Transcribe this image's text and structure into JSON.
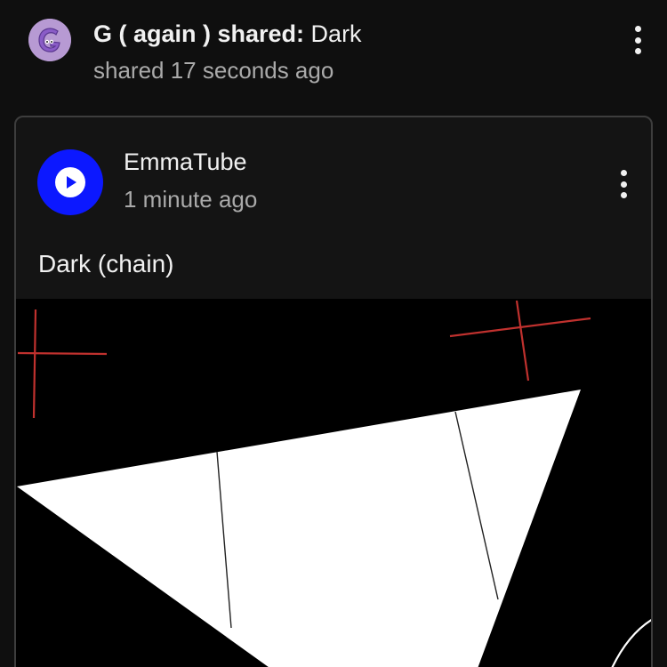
{
  "share": {
    "sharer_name": "G ( again ) shared:",
    "shared_title": " Dark",
    "time": "shared 17 seconds ago",
    "avatar_icon": "letter-g-avatar-icon",
    "avatar_color": "#b79ad3"
  },
  "post": {
    "channel_name": "EmmaTube",
    "time": "1 minute ago",
    "text": "Dark (chain)",
    "avatar_icon": "play-icon",
    "avatar_color": "#0c18ff",
    "image_icon": "abstract-white-shape-on-black"
  },
  "colors": {
    "background": "#0f0f0f",
    "card_border": "#3d3d3d",
    "secondary_text": "#aaaaaa",
    "cross_marks": "#c0312e"
  }
}
